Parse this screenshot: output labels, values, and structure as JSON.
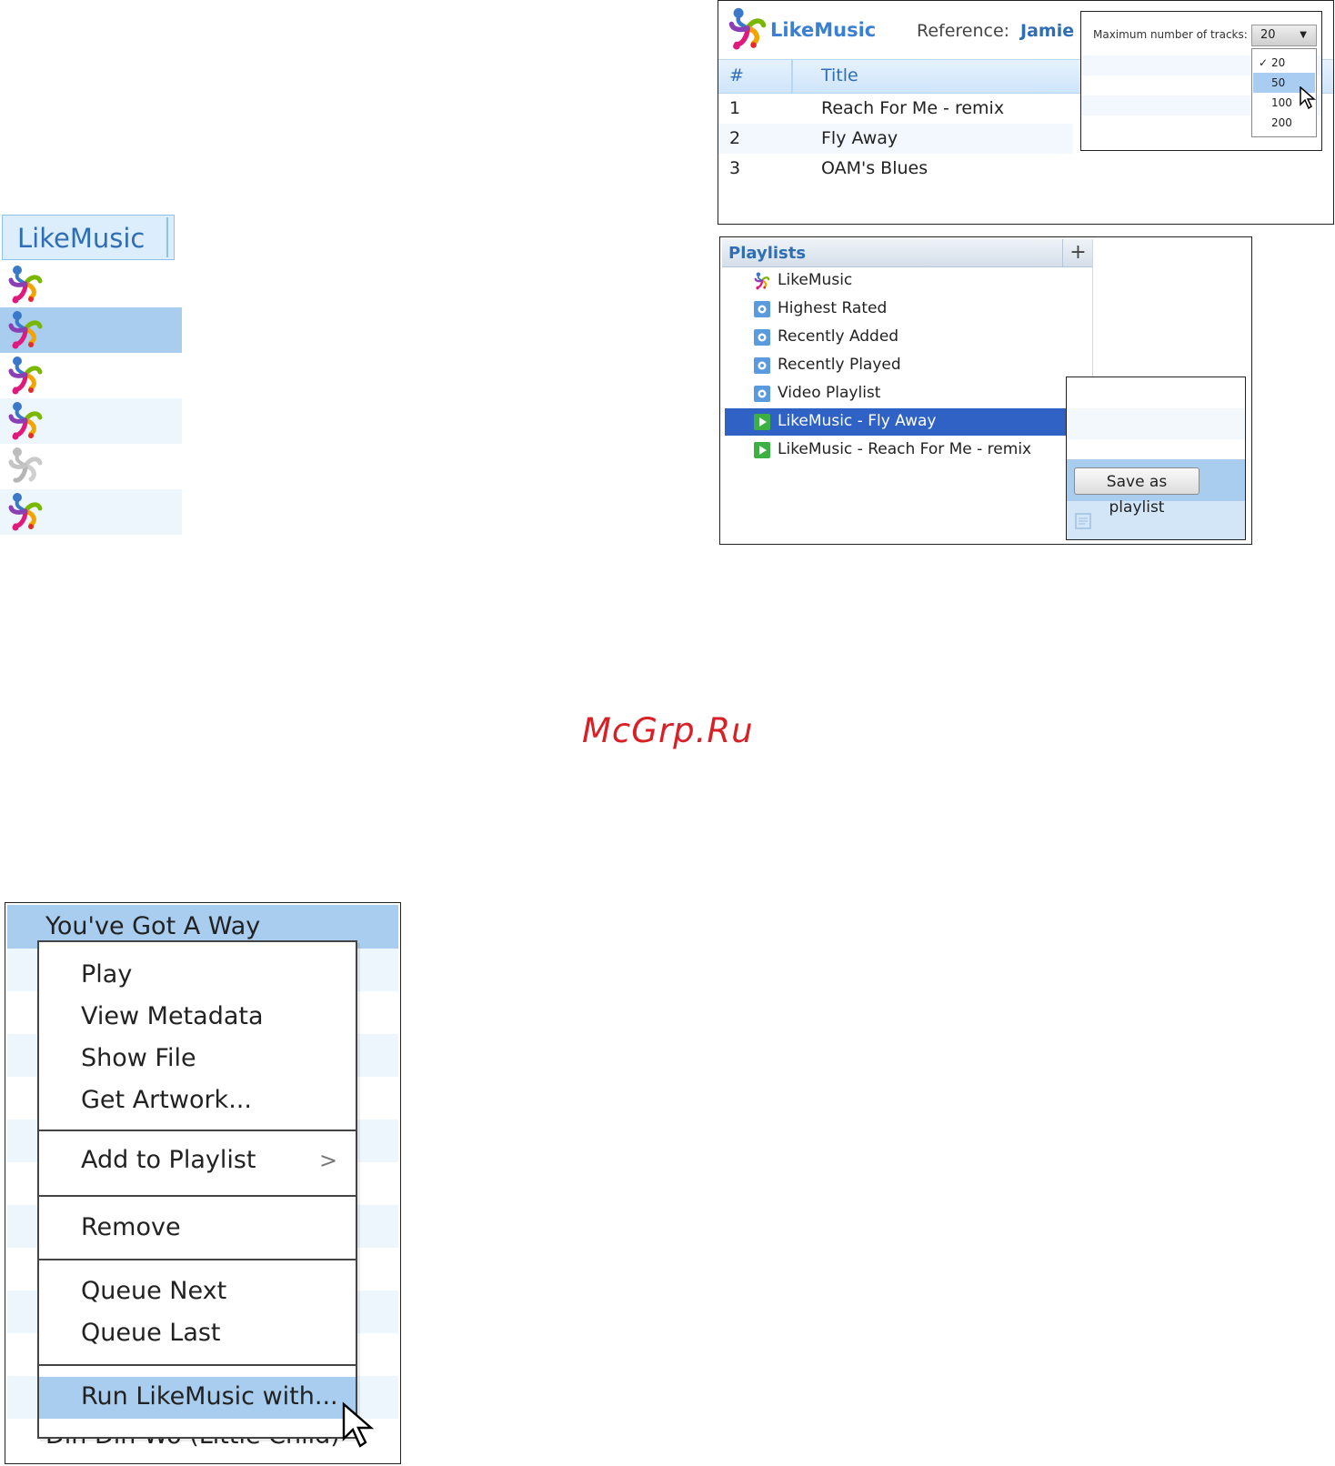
{
  "column_panel": {
    "header": "LikeMusic",
    "row_count_note": ""
  },
  "top_panel": {
    "brand": "LikeMusic",
    "reference_label": "Reference:",
    "reference_value": "Jamie",
    "columns": {
      "num": "#",
      "title": "Title"
    },
    "tracks": [
      {
        "num": "1",
        "title": "Reach For Me - remix"
      },
      {
        "num": "2",
        "title": "Fly Away"
      },
      {
        "num": "3",
        "title": "OAM's Blues"
      }
    ],
    "options": {
      "label": "Maximum number of tracks:",
      "selected": "20",
      "choices": [
        "20",
        "50",
        "100",
        "200"
      ],
      "checked": "20",
      "hovered": "50"
    }
  },
  "playlists_panel": {
    "title": "Playlists",
    "add_label": "+",
    "items": [
      {
        "label": "LikeMusic",
        "icon": "likemusic-logo-icon"
      },
      {
        "label": "Highest Rated",
        "icon": "smart-playlist-icon"
      },
      {
        "label": "Recently Added",
        "icon": "smart-playlist-icon"
      },
      {
        "label": "Recently Played",
        "icon": "smart-playlist-icon"
      },
      {
        "label": "Video Playlist",
        "icon": "smart-playlist-icon"
      },
      {
        "label": "LikeMusic - Fly Away",
        "icon": "play-playlist-icon",
        "selected": true
      },
      {
        "label": "LikeMusic - Reach For Me - remix",
        "icon": "play-playlist-icon"
      }
    ],
    "save_button": "Save as playlist"
  },
  "watermark": "McGrp.Ru",
  "context_panel": {
    "top_row": "You've Got A Way",
    "bottom_row": "Din Din Wo (Little Child)",
    "menu": {
      "play": "Play",
      "view_metadata": "View Metadata",
      "show_file": "Show File",
      "get_artwork": "Get Artwork...",
      "add_to_playlist": "Add to Playlist",
      "remove": "Remove",
      "queue_next": "Queue Next",
      "queue_last": "Queue Last",
      "run_likemusic": "Run LikeMusic with..."
    }
  },
  "colors": {
    "accent_blue": "#2f6db5",
    "selection_blue": "#2f62c4",
    "row_highlight": "#a9cdee",
    "watermark_red": "#d82027"
  }
}
